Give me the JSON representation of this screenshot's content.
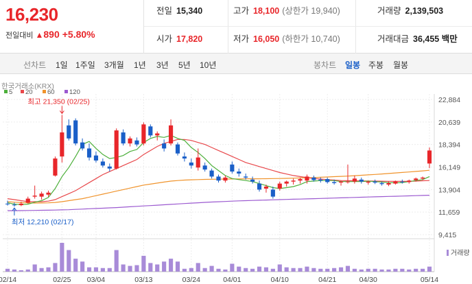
{
  "quote": {
    "current_price": "16,230",
    "change_label": "전일대비",
    "change_arrow": "▲",
    "change_value": "890",
    "change_percent": "+5.80%",
    "prev_close_label": "전일",
    "prev_close": "15,340",
    "high_label": "고가",
    "high": "18,100",
    "upper_limit": "(상한가 19,940)",
    "volume_label": "거래량",
    "volume": "2,139,503",
    "open_label": "시가",
    "open": "17,820",
    "low_label": "저가",
    "low": "16,050",
    "lower_limit": "(하한가 10,740)",
    "amount_label": "거래대금",
    "amount": "36,455 백만"
  },
  "toolbar": {
    "line_chart_label": "선차트",
    "periods": [
      "1일",
      "1주일",
      "3개월",
      "1년",
      "3년",
      "5년",
      "10년"
    ],
    "candle_chart_label": "봉차트",
    "candle_types": [
      "일봉",
      "주봉",
      "월봉"
    ],
    "active_candle_type": "일봉"
  },
  "colors": {
    "up": "#e8262a",
    "down": "#1a5fc8",
    "ma5": "#4caf3a",
    "ma20": "#e8474a",
    "ma60": "#f0932b",
    "ma120": "#9b59d0",
    "volume": "#a88bd8"
  },
  "chart_data": {
    "type": "candlestick",
    "source_label": "한국거래소(KRX)",
    "legend": [
      {
        "name": "5",
        "color": "#4caf3a"
      },
      {
        "name": "20",
        "color": "#e8474a"
      },
      {
        "name": "60",
        "color": "#f0932b"
      },
      {
        "name": "120",
        "color": "#9b59d0"
      }
    ],
    "y_ticks": [
      "22,884",
      "20,639",
      "18,394",
      "16,149",
      "13,904",
      "11,659",
      "9,415"
    ],
    "y_tick_values": [
      22884,
      20639,
      18394,
      16149,
      13904,
      11659,
      9415
    ],
    "ylim": [
      9415,
      22884
    ],
    "x_ticks": [
      "02/14",
      "02/25",
      "03/04",
      "03/13",
      "03/24",
      "04/01",
      "04/10",
      "04/21",
      "04/30",
      "05/14"
    ],
    "x_tick_index": [
      0,
      8,
      13,
      20,
      27,
      33,
      40,
      47,
      53,
      62
    ],
    "max_annotation": {
      "label": "최고 21,350 (02/25)",
      "index": 8,
      "value": 21350
    },
    "min_annotation": {
      "label": "최저 12,210 (02/17)",
      "index": 1,
      "value": 12210
    },
    "volume_label": "거래량",
    "candles": [
      {
        "o": 12500,
        "h": 12800,
        "l": 12300,
        "c": 12450
      },
      {
        "o": 12400,
        "h": 12600,
        "l": 12210,
        "c": 12350
      },
      {
        "o": 12350,
        "h": 12700,
        "l": 12250,
        "c": 12500
      },
      {
        "o": 12600,
        "h": 13200,
        "l": 12500,
        "c": 13000
      },
      {
        "o": 13200,
        "h": 14300,
        "l": 13000,
        "c": 13300
      },
      {
        "o": 13200,
        "h": 13700,
        "l": 12900,
        "c": 13500
      },
      {
        "o": 13400,
        "h": 13800,
        "l": 13200,
        "c": 13600
      },
      {
        "o": 15300,
        "h": 17200,
        "l": 15200,
        "c": 17000
      },
      {
        "o": 17200,
        "h": 21350,
        "l": 16600,
        "c": 19600
      },
      {
        "o": 20300,
        "h": 20900,
        "l": 18800,
        "c": 19000
      },
      {
        "o": 20800,
        "h": 21000,
        "l": 18300,
        "c": 18500
      },
      {
        "o": 18600,
        "h": 19000,
        "l": 17800,
        "c": 18000
      },
      {
        "o": 18000,
        "h": 18500,
        "l": 16800,
        "c": 17100
      },
      {
        "o": 17300,
        "h": 17700,
        "l": 16600,
        "c": 16800
      },
      {
        "o": 16700,
        "h": 17000,
        "l": 16100,
        "c": 16300
      },
      {
        "o": 16200,
        "h": 16500,
        "l": 15700,
        "c": 16000
      },
      {
        "o": 16000,
        "h": 20000,
        "l": 15900,
        "c": 19800
      },
      {
        "o": 19600,
        "h": 19900,
        "l": 18300,
        "c": 18500
      },
      {
        "o": 18500,
        "h": 19200,
        "l": 18200,
        "c": 19000
      },
      {
        "o": 18800,
        "h": 19100,
        "l": 18200,
        "c": 18400
      },
      {
        "o": 18500,
        "h": 20600,
        "l": 18300,
        "c": 20400
      },
      {
        "o": 20200,
        "h": 20400,
        "l": 19100,
        "c": 19300
      },
      {
        "o": 19300,
        "h": 19700,
        "l": 18800,
        "c": 19500
      },
      {
        "o": 18500,
        "h": 18900,
        "l": 17700,
        "c": 18000
      },
      {
        "o": 18500,
        "h": 20900,
        "l": 18300,
        "c": 20300
      },
      {
        "o": 18400,
        "h": 18600,
        "l": 17300,
        "c": 17500
      },
      {
        "o": 17200,
        "h": 17600,
        "l": 16700,
        "c": 17000
      },
      {
        "o": 16600,
        "h": 17000,
        "l": 16000,
        "c": 16300
      },
      {
        "o": 16100,
        "h": 18000,
        "l": 15800,
        "c": 17100
      },
      {
        "o": 16300,
        "h": 16600,
        "l": 15700,
        "c": 15900
      },
      {
        "o": 15800,
        "h": 16000,
        "l": 15000,
        "c": 15200
      },
      {
        "o": 15200,
        "h": 15400,
        "l": 14600,
        "c": 14800
      },
      {
        "o": 14800,
        "h": 15300,
        "l": 14600,
        "c": 15100
      },
      {
        "o": 16400,
        "h": 16700,
        "l": 15500,
        "c": 15700
      },
      {
        "o": 15700,
        "h": 16000,
        "l": 15200,
        "c": 15500
      },
      {
        "o": 15200,
        "h": 15500,
        "l": 14900,
        "c": 15100
      },
      {
        "o": 14900,
        "h": 15200,
        "l": 14500,
        "c": 14700
      },
      {
        "o": 14500,
        "h": 14800,
        "l": 13700,
        "c": 13900
      },
      {
        "o": 14000,
        "h": 14400,
        "l": 13600,
        "c": 14200
      },
      {
        "o": 13900,
        "h": 14200,
        "l": 13000,
        "c": 13200
      },
      {
        "o": 14000,
        "h": 14700,
        "l": 13800,
        "c": 14500
      },
      {
        "o": 14500,
        "h": 14800,
        "l": 14200,
        "c": 14700
      },
      {
        "o": 14700,
        "h": 15000,
        "l": 14400,
        "c": 14800
      },
      {
        "o": 14800,
        "h": 15100,
        "l": 14500,
        "c": 14950
      },
      {
        "o": 14800,
        "h": 15400,
        "l": 14500,
        "c": 15200
      },
      {
        "o": 15100,
        "h": 15300,
        "l": 14700,
        "c": 14850
      },
      {
        "o": 14900,
        "h": 15100,
        "l": 14600,
        "c": 14800
      },
      {
        "o": 14950,
        "h": 15100,
        "l": 14500,
        "c": 14650
      },
      {
        "o": 14650,
        "h": 14900,
        "l": 14400,
        "c": 14550
      },
      {
        "o": 14600,
        "h": 14800,
        "l": 14300,
        "c": 14700
      },
      {
        "o": 14650,
        "h": 16400,
        "l": 14500,
        "c": 14700
      },
      {
        "o": 14700,
        "h": 15300,
        "l": 14500,
        "c": 15000
      },
      {
        "o": 14900,
        "h": 15100,
        "l": 14500,
        "c": 14700
      },
      {
        "o": 14600,
        "h": 14800,
        "l": 14400,
        "c": 14700
      },
      {
        "o": 14700,
        "h": 14900,
        "l": 14450,
        "c": 14600
      },
      {
        "o": 14550,
        "h": 14700,
        "l": 14300,
        "c": 14450
      },
      {
        "o": 14400,
        "h": 14700,
        "l": 14250,
        "c": 14550
      },
      {
        "o": 14500,
        "h": 14800,
        "l": 14400,
        "c": 14700
      },
      {
        "o": 14700,
        "h": 14900,
        "l": 14500,
        "c": 14650
      },
      {
        "o": 14650,
        "h": 14900,
        "l": 14500,
        "c": 14800
      },
      {
        "o": 14850,
        "h": 15100,
        "l": 14700,
        "c": 15000
      },
      {
        "o": 15000,
        "h": 15200,
        "l": 14850,
        "c": 15100
      },
      {
        "o": 16500,
        "h": 18100,
        "l": 16050,
        "c": 17800
      }
    ],
    "ma5": [
      12600,
      12450,
      12400,
      12450,
      12640,
      12800,
      13120,
      14000,
      15200,
      16100,
      17200,
      18400,
      18700,
      18000,
      17400,
      17000,
      17100,
      17300,
      17700,
      17900,
      18600,
      19000,
      19200,
      19100,
      19300,
      19000,
      18800,
      18100,
      17600,
      17000,
      16300,
      15800,
      15300,
      15000,
      14900,
      14800,
      14700,
      14500,
      14300,
      14100,
      14000,
      14100,
      14200,
      14400,
      14700,
      14750,
      14800,
      14800,
      14800,
      14700,
      14700,
      14700,
      14700,
      14750,
      14700,
      14650,
      14600,
      14580,
      14600,
      14700,
      14800,
      14900,
      15200
    ],
    "ma20": [
      13000,
      12900,
      12800,
      12700,
      12700,
      12700,
      12750,
      12900,
      13200,
      13500,
      13800,
      14200,
      14600,
      15000,
      15400,
      15700,
      16000,
      16300,
      16600,
      16900,
      17400,
      17800,
      18200,
      18500,
      18700,
      18900,
      18900,
      18800,
      18600,
      18400,
      18100,
      17800,
      17500,
      17200,
      16900,
      16600,
      16400,
      16200,
      16000,
      15800,
      15600,
      15450,
      15300,
      15200,
      15100,
      15000,
      14950,
      14900,
      14850,
      14800,
      14790,
      14780,
      14770,
      14760,
      14750,
      14740,
      14730,
      14720,
      14720,
      14730,
      14750,
      14780,
      14800
    ],
    "ma60": [
      12700,
      12650,
      12600,
      12580,
      12560,
      12570,
      12580,
      12620,
      12700,
      12800,
      12900,
      13000,
      13150,
      13300,
      13450,
      13600,
      13750,
      13900,
      14050,
      14200,
      14350,
      14450,
      14550,
      14650,
      14750,
      14800,
      14850,
      14880,
      14900,
      14920,
      14930,
      14940,
      14950,
      14960,
      14970,
      14980,
      14980,
      14980,
      14990,
      15000,
      15010,
      15020,
      15040,
      15060,
      15080,
      15100,
      15130,
      15160,
      15190,
      15220,
      15250,
      15290,
      15330,
      15370,
      15410,
      15460,
      15510,
      15560,
      15610,
      15660,
      15710,
      15770,
      15830
    ],
    "ma120": [
      11800,
      11800,
      11810,
      11820,
      11830,
      11840,
      11850,
      11860,
      11880,
      11900,
      11930,
      11960,
      11990,
      12020,
      12050,
      12080,
      12110,
      12150,
      12190,
      12230,
      12270,
      12310,
      12350,
      12390,
      12430,
      12470,
      12510,
      12550,
      12590,
      12630,
      12660,
      12690,
      12720,
      12750,
      12780,
      12800,
      12820,
      12840,
      12860,
      12880,
      12900,
      12920,
      12940,
      12960,
      12980,
      13000,
      13020,
      13040,
      13060,
      13080,
      13100,
      13120,
      13140,
      13160,
      13180,
      13200,
      13220,
      13240,
      13260,
      13280,
      13300,
      13320,
      13340
    ],
    "volume": [
      4,
      3,
      2,
      3,
      10,
      5,
      6,
      12,
      40,
      30,
      18,
      14,
      6,
      6,
      5,
      5,
      30,
      10,
      8,
      9,
      22,
      12,
      10,
      14,
      18,
      14,
      4,
      5,
      12,
      5,
      8,
      4,
      3,
      11,
      7,
      5,
      4,
      7,
      6,
      4,
      10,
      6,
      5,
      5,
      7,
      5,
      4,
      4,
      5,
      6,
      8,
      4,
      3,
      4,
      4,
      3,
      3,
      4,
      4,
      3,
      4,
      4,
      7
    ]
  }
}
